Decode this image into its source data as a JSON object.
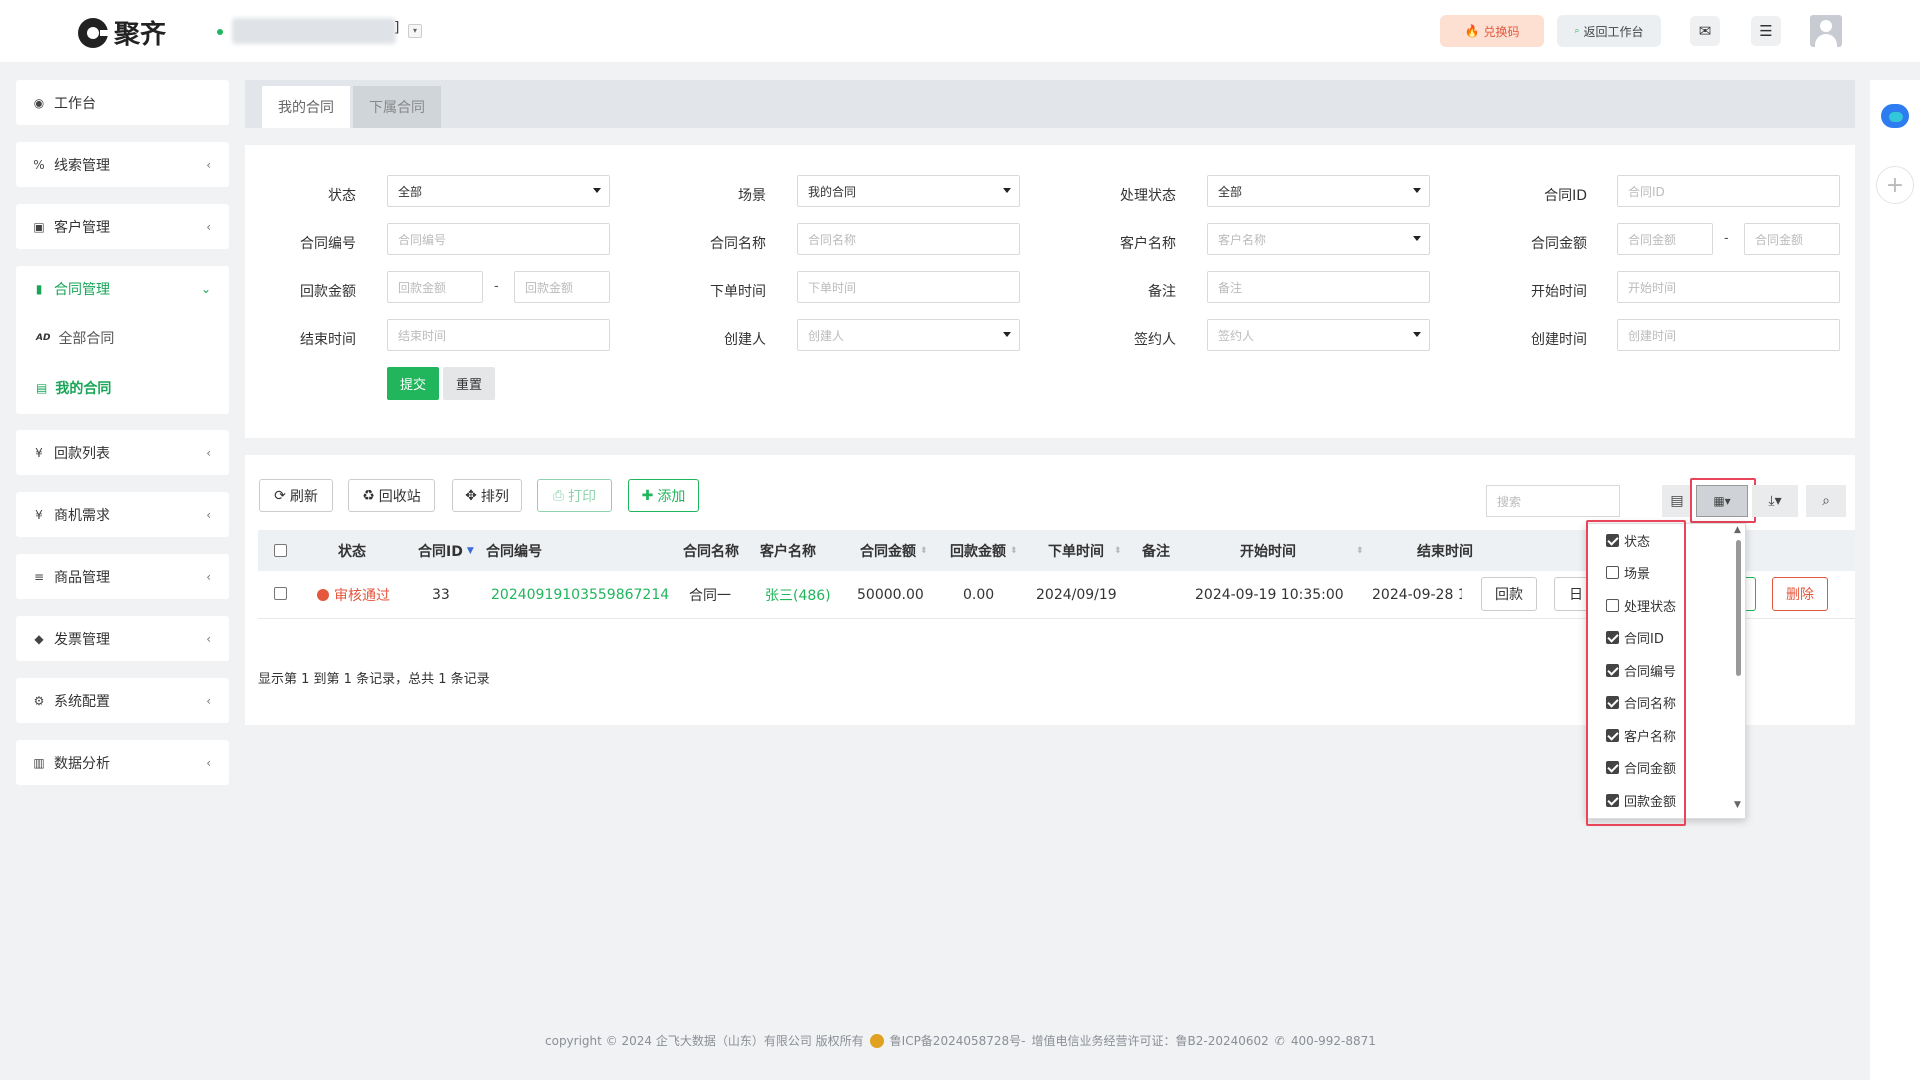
{
  "header": {
    "brand": "聚齐",
    "workspace_suffix": "]",
    "workspace_caret": "▾",
    "redeem": "兑换码",
    "return": "返回工作台"
  },
  "sidebar": {
    "items": [
      {
        "label": "工作台",
        "icon": "dashboard-icon"
      },
      {
        "label": "线索管理",
        "icon": "link-icon"
      },
      {
        "label": "客户管理",
        "icon": "id-card-icon"
      },
      {
        "label": "合同管理",
        "icon": "bookmark-icon"
      },
      {
        "label": "回款列表",
        "icon": "yen-icon"
      },
      {
        "label": "商机需求",
        "icon": "yen-icon"
      },
      {
        "label": "商品管理",
        "icon": "list-icon"
      },
      {
        "label": "发票管理",
        "icon": "tag-icon"
      },
      {
        "label": "系统配置",
        "icon": "gears-icon"
      },
      {
        "label": "数据分析",
        "icon": "bar-chart-icon"
      }
    ],
    "sub": [
      {
        "label": "全部合同"
      },
      {
        "label": "我的合同"
      }
    ]
  },
  "tabs": [
    {
      "label": "我的合同"
    },
    {
      "label": "下属合同"
    }
  ],
  "filters": {
    "status": {
      "label": "状态",
      "value": "全部"
    },
    "scene": {
      "label": "场景",
      "value": "我的合同"
    },
    "proc": {
      "label": "处理状态",
      "value": "全部"
    },
    "cid": {
      "label": "合同ID",
      "placeholder": "合同ID"
    },
    "cno": {
      "label": "合同编号",
      "placeholder": "合同编号"
    },
    "cname": {
      "label": "合同名称",
      "placeholder": "合同名称"
    },
    "cust": {
      "label": "客户名称",
      "placeholder": "客户名称"
    },
    "amount": {
      "label": "合同金额",
      "from": "合同金额",
      "to": "合同金额"
    },
    "payback": {
      "label": "回款金额",
      "from": "回款金额",
      "to": "回款金额"
    },
    "order": {
      "label": "下单时间",
      "placeholder": "下单时间"
    },
    "remark": {
      "label": "备注",
      "placeholder": "备注"
    },
    "start": {
      "label": "开始时间",
      "placeholder": "开始时间"
    },
    "end": {
      "label": "结束时间",
      "placeholder": "结束时间"
    },
    "creator": {
      "label": "创建人",
      "placeholder": "创建人"
    },
    "signer": {
      "label": "签约人",
      "placeholder": "签约人"
    },
    "ctime": {
      "label": "创建时间",
      "placeholder": "创建时间"
    },
    "dash": "-",
    "submit": "提交",
    "reset": "重置"
  },
  "toolbar": {
    "refresh": "刷新",
    "recycle": "回收站",
    "arrange": "排列",
    "print": "打印",
    "add": "添加",
    "search_placeholder": "搜索"
  },
  "table": {
    "headers": [
      "状态",
      "合同ID",
      "合同编号",
      "合同名称",
      "客户名称",
      "合同金额",
      "回款金额",
      "下单时间",
      "备注",
      "开始时间",
      "结束时间"
    ],
    "rows": [
      {
        "status": "审核通过",
        "id": "33",
        "no": "20240919103559867214",
        "name": "合同一",
        "customer": "张三(486)",
        "amount": "50000.00",
        "payback": "0.00",
        "order_date": "2024/09/19",
        "remark": "",
        "start": "2024-09-19 10:35:00",
        "end": "2024-09-28 1"
      }
    ],
    "actions": {
      "payback": "回款",
      "log_partial": "日",
      "delete": "删除"
    },
    "pager": "显示第 1 到第 1 条记录，总共 1 条记录"
  },
  "columns_menu": [
    {
      "label": "状态",
      "checked": true
    },
    {
      "label": "场景",
      "checked": false
    },
    {
      "label": "处理状态",
      "checked": false
    },
    {
      "label": "合同ID",
      "checked": true
    },
    {
      "label": "合同编号",
      "checked": true
    },
    {
      "label": "合同名称",
      "checked": true
    },
    {
      "label": "客户名称",
      "checked": true
    },
    {
      "label": "合同金额",
      "checked": true
    },
    {
      "label": "回款金额",
      "checked": true
    }
  ],
  "footer": {
    "copyright": "copyright © 2024 企飞大数据（山东）有限公司 版权所有",
    "icp": "鲁ICP备2024058728号-",
    "license": "增值电信业务经营许可证：鲁B2-20240602",
    "phone": "400-992-8871"
  },
  "colors": {
    "accent": "#21b55c",
    "danger": "#e4573d",
    "highlight": "#e8455a"
  }
}
